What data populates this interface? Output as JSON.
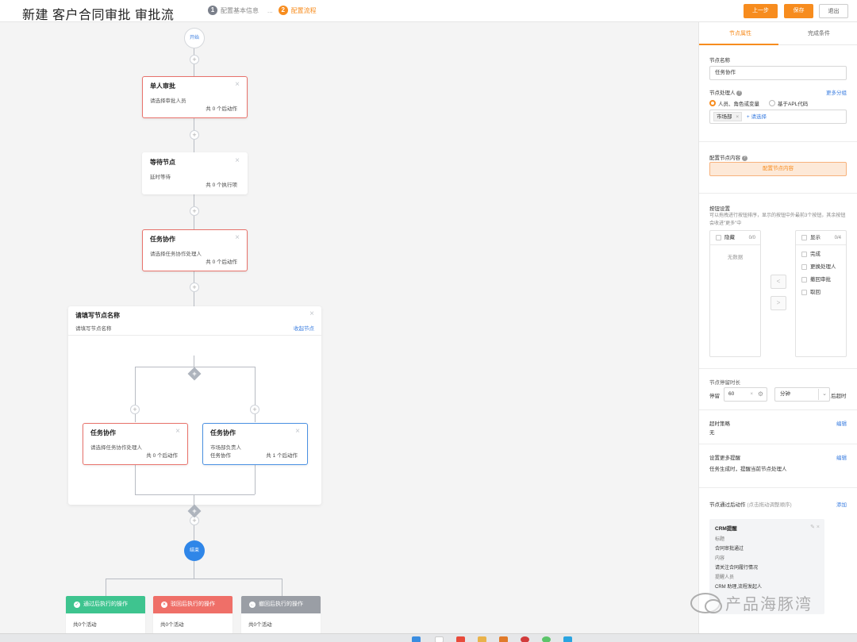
{
  "header": {
    "title": "新建 客户合同审批 审批流",
    "steps": [
      {
        "num": "1",
        "label": "配置基本信息"
      },
      {
        "num": "2",
        "label": "配置流程"
      }
    ],
    "step_separator": "...",
    "buttons": {
      "prev": "上一步",
      "save": "保存",
      "exit": "退出"
    }
  },
  "canvas": {
    "start_label": "开始",
    "end_label": "结束",
    "plus_symbol": "+",
    "close_symbol": "×",
    "nodes": [
      {
        "title": "单人审批",
        "subtitle": "请选择审批人员",
        "count": "共 0 个后动作"
      },
      {
        "title": "等待节点",
        "subtitle": "延时等待",
        "count": "共 0 个执行项"
      },
      {
        "title": "任务协作",
        "subtitle": "请选择任务协作处理人",
        "count": "共 0 个后动作"
      }
    ],
    "branch": {
      "title": "请填写节点名称",
      "subtitle": "请填写节点名称",
      "collapse_label": "收起节点",
      "left": {
        "title": "任务协作",
        "subtitle": "请选择任务协作处理人",
        "count": "共 0 个后动作"
      },
      "right": {
        "title": "任务协作",
        "subtitle": "市场部负责人",
        "extra": "任务协作",
        "count": "共 1 个后动作"
      }
    },
    "actions": [
      {
        "label": "通过后执行的操作",
        "count": "共0个活动",
        "color": "#3ec48f",
        "icon": "✓"
      },
      {
        "label": "驳回后执行的操作",
        "count": "共0个活动",
        "color": "#ef6f68",
        "icon": "×"
      },
      {
        "label": "撤回后执行的操作",
        "count": "共0个活动",
        "color": "#9a9ea5",
        "icon": "←"
      }
    ]
  },
  "panel": {
    "tabs": [
      "节点属性",
      "完成条件"
    ],
    "node_name_label": "节点名称",
    "node_name_value": "任务协作",
    "handler_label": "节点处理人",
    "more_groups": "更多分组",
    "handler_options": [
      "人员、角色或变量",
      "基于APL代码"
    ],
    "handler_tag": "市场部",
    "tag_close": "×",
    "add_select": "+ 请选择",
    "content_label": "配置节点内容",
    "config_button": "配置节点内容",
    "button_setting_label": "按钮设置",
    "button_setting_desc": "可以拖拽进行按钮排序，显示的按钮中外最前3个按钮，其余按钮会收进\"更多\"中",
    "hidden": {
      "label": "隐藏",
      "count": "0/0",
      "empty": "无数据"
    },
    "shown": {
      "label": "显示",
      "count": "0/4",
      "items": [
        "完成",
        "更换处理人",
        "撤回审批",
        "取回"
      ]
    },
    "arrows": {
      "left": "<",
      "right": ">"
    },
    "stay_label": "节点停留时长",
    "stay_prefix": "停留",
    "stay_value": "60",
    "stay_unit": "分钟",
    "stay_suffix": "后超时",
    "timeout_label": "超时策略",
    "timeout_value": "无",
    "edit": "编辑",
    "remind_label": "设置更多提醒",
    "remind_value": "任务生成时，提醒当前节点处理人",
    "post_label": "节点通过后动作",
    "post_hint": "(点击拖动调整顺序)",
    "post_add": "添加",
    "post_card": {
      "title": "CRM提醒",
      "rows": [
        {
          "key": "标题",
          "value": "合同审批通过"
        },
        {
          "key": "内容",
          "value": "请关注合同履行情况"
        },
        {
          "key": "提醒人员",
          "value": "CRM 助理,流程发起人"
        }
      ]
    }
  },
  "watermark": "产品海豚湾"
}
